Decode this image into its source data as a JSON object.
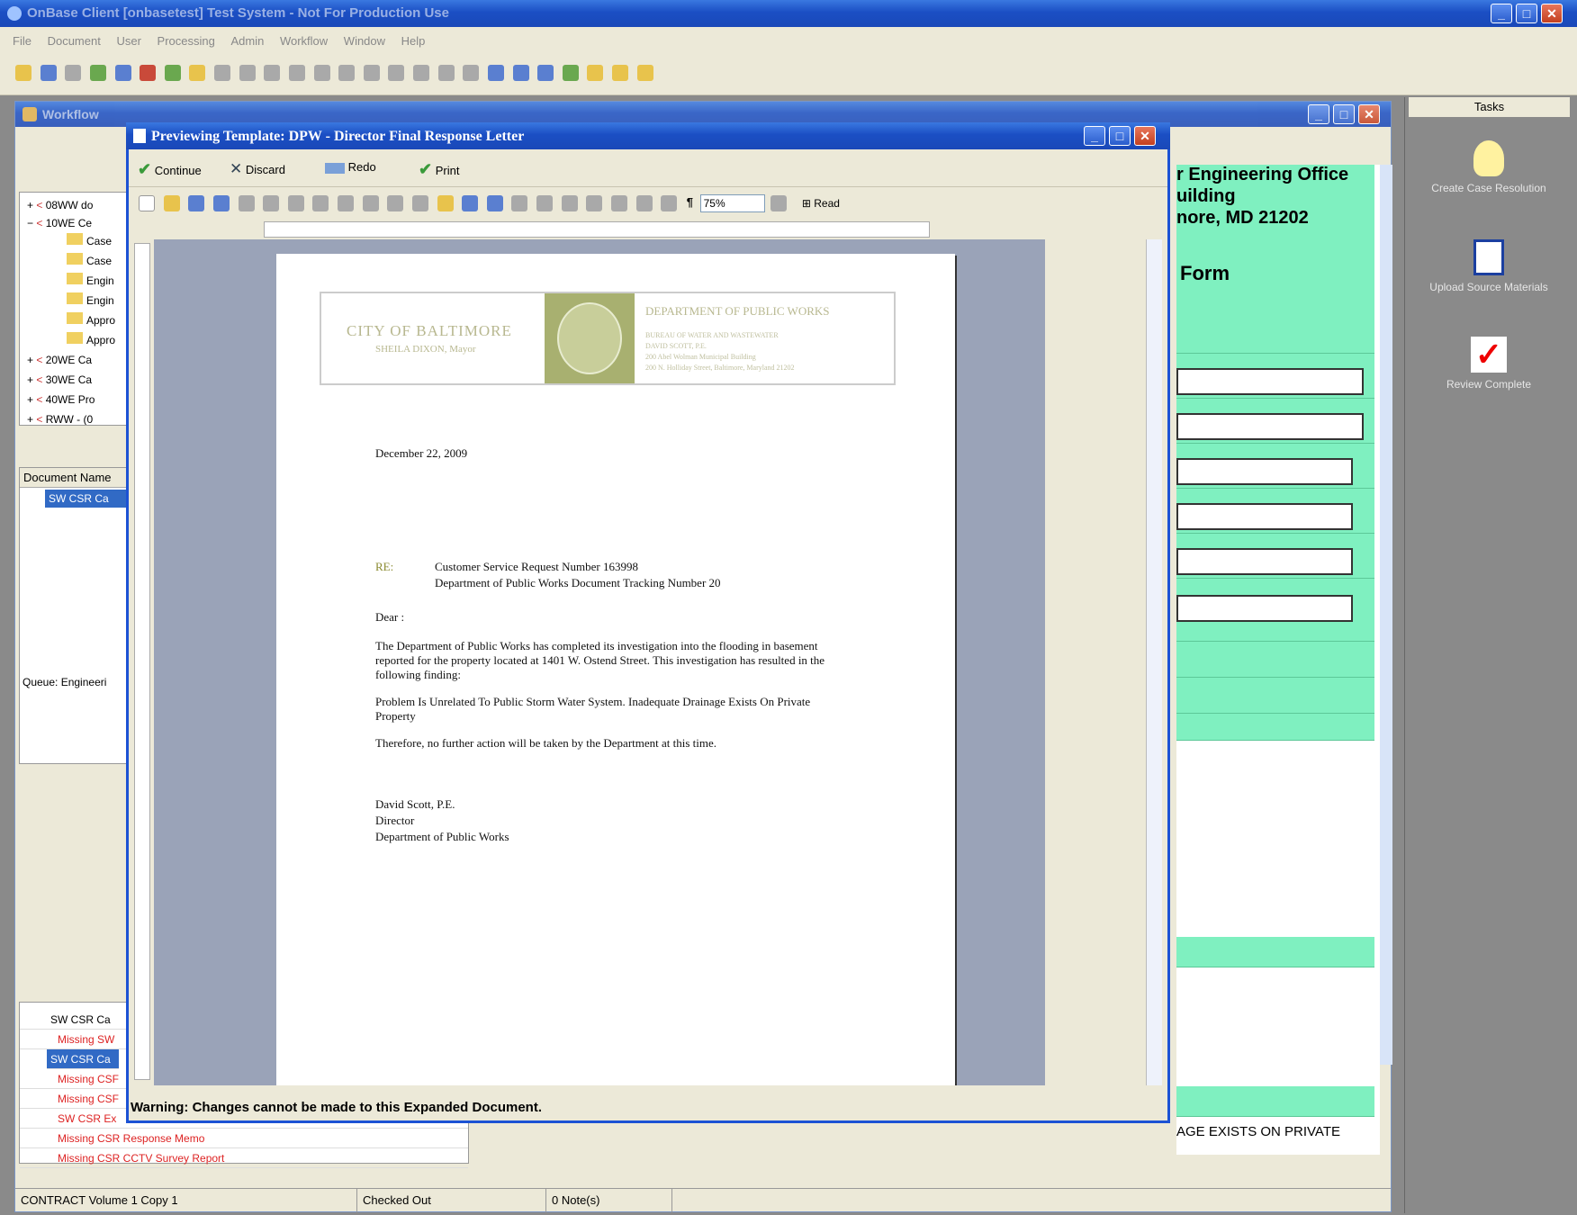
{
  "app": {
    "title": "OnBase Client [onbasetest] Test System - Not For Production Use",
    "menu": [
      "File",
      "Document",
      "User",
      "Processing",
      "Admin",
      "Workflow",
      "Window",
      "Help"
    ]
  },
  "workflow": {
    "title": "Workflow",
    "tree": [
      {
        "label": "08WW do",
        "kind": "queue"
      },
      {
        "label": "10WE Ce",
        "kind": "queue"
      },
      {
        "label": "Case",
        "kind": "folder"
      },
      {
        "label": "Case",
        "kind": "folder"
      },
      {
        "label": "Engin",
        "kind": "folder"
      },
      {
        "label": "Engin",
        "kind": "folder"
      },
      {
        "label": "Appro",
        "kind": "folder"
      },
      {
        "label": "Appro",
        "kind": "folder"
      },
      {
        "label": "20WE Ca",
        "kind": "queue"
      },
      {
        "label": "30WE Ca",
        "kind": "queue"
      },
      {
        "label": "40WE Pro",
        "kind": "queue"
      },
      {
        "label": "RWW - (0",
        "kind": "queue"
      }
    ],
    "document_name_header": "Document Name",
    "selected_doc": "SW CSR Ca",
    "queue_label": "Queue: Engineeri",
    "related": [
      {
        "label": "SW CSR Ca",
        "style": "normal"
      },
      {
        "label": "Missing SW",
        "style": "missing"
      },
      {
        "label": "SW CSR Ca",
        "style": "selected"
      },
      {
        "label": "Missing CSF",
        "style": "missing"
      },
      {
        "label": "Missing CSF",
        "style": "missing"
      },
      {
        "label": "SW CSR Ex",
        "style": "missing"
      },
      {
        "label": "Missing CSR Response Memo",
        "style": "missing"
      },
      {
        "label": "Missing CSR CCTV Survey Report",
        "style": "missing"
      }
    ],
    "form_lines": [
      "r Engineering Office",
      "uilding",
      "nore, MD 21202"
    ],
    "form_title": "Form",
    "form_text": "AGE EXISTS ON PRIVATE"
  },
  "tasks": {
    "header": "Tasks",
    "items": [
      {
        "label": "Create Case Resolution",
        "icon": "lightbulb-icon"
      },
      {
        "label": "Upload Source Materials",
        "icon": "upload-arrow-icon"
      },
      {
        "label": "Review Complete",
        "icon": "red-checkmark-icon"
      }
    ]
  },
  "preview": {
    "title": "Previewing Template: DPW - Director Final Response Letter",
    "buttons": {
      "continue": "Continue",
      "discard": "Discard",
      "redo": "Redo",
      "print": "Print"
    },
    "zoom": "75%",
    "read_label": "Read",
    "warning": "Warning: Changes cannot be made to this Expanded Document.",
    "letter": {
      "city": "CITY OF BALTIMORE",
      "mayor": "SHEILA DIXON, Mayor",
      "department": "DEPARTMENT OF PUBLIC WORKS",
      "address_lines": [
        "BUREAU OF WATER AND WASTEWATER",
        "DAVID SCOTT, P.E.",
        "200 Abel Wolman Municipal Building",
        "200 N. Holliday Street, Baltimore, Maryland 21202"
      ],
      "date": "December 22, 2009",
      "re_label": "RE:",
      "re_line1": "Customer Service Request Number 163998",
      "re_line2": "Department of Public Works Document Tracking Number 20",
      "salutation": "Dear :",
      "para1": "The Department of Public Works has completed its investigation into the flooding in basement reported for the property located at 1401 W. Ostend Street. This investigation has resulted in the following finding:",
      "para2": "Problem Is Unrelated To Public Storm Water System. Inadequate Drainage Exists On Private Property",
      "para3": "Therefore, no further action will be taken by the Department at this time.",
      "sig_name": "David Scott, P.E.",
      "sig_title": "Director",
      "sig_dept": "Department of Public Works"
    }
  },
  "status": {
    "volume": "CONTRACT Volume 1 Copy 1",
    "checked": "Checked Out",
    "notes": "0 Note(s)"
  }
}
